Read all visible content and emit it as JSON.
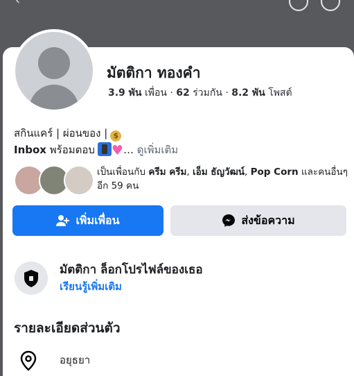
{
  "profile": {
    "name": "มัตติกา ทองคำ",
    "stats": {
      "friends_count": "3.9 พัน",
      "friends_label": "เพื่อน",
      "mutual_count": "62",
      "mutual_label": "ร่วมกัน",
      "posts_count": "8.2 พัน",
      "posts_label": "โพสต์",
      "separator": "·"
    },
    "bio": {
      "line1": "สกินแคร์ | ผ่อนของ |",
      "inbox": "Inbox",
      "line2_rest": "พร้อมตอบ",
      "ellipsis": "…",
      "see_more": "ดูเพิ่มเติม"
    },
    "mutual": {
      "prefix": "เป็นเพื่อนกับ",
      "friend1": "ครีม ครีม",
      "friend2": "เอ็ม ธัญวัฒน์",
      "friend3": "Pop Corn",
      "suffix": "และคนอื่นๆ อีก 59 คน"
    }
  },
  "actions": {
    "add_friend": "เพิ่มเพื่อน",
    "message": "ส่งข้อความ"
  },
  "lock_notice": {
    "title": "มัตติกา ล็อกโปรไฟล์ของเธอ",
    "link": "เรียนรู้เพิ่มเติม"
  },
  "details": {
    "title": "รายละเอียดส่วนตัว",
    "location": "อยุธยา"
  },
  "colors": {
    "primary": "#1877f2",
    "secondary_button": "#e4e6eb",
    "header_bg": "#58595d"
  }
}
